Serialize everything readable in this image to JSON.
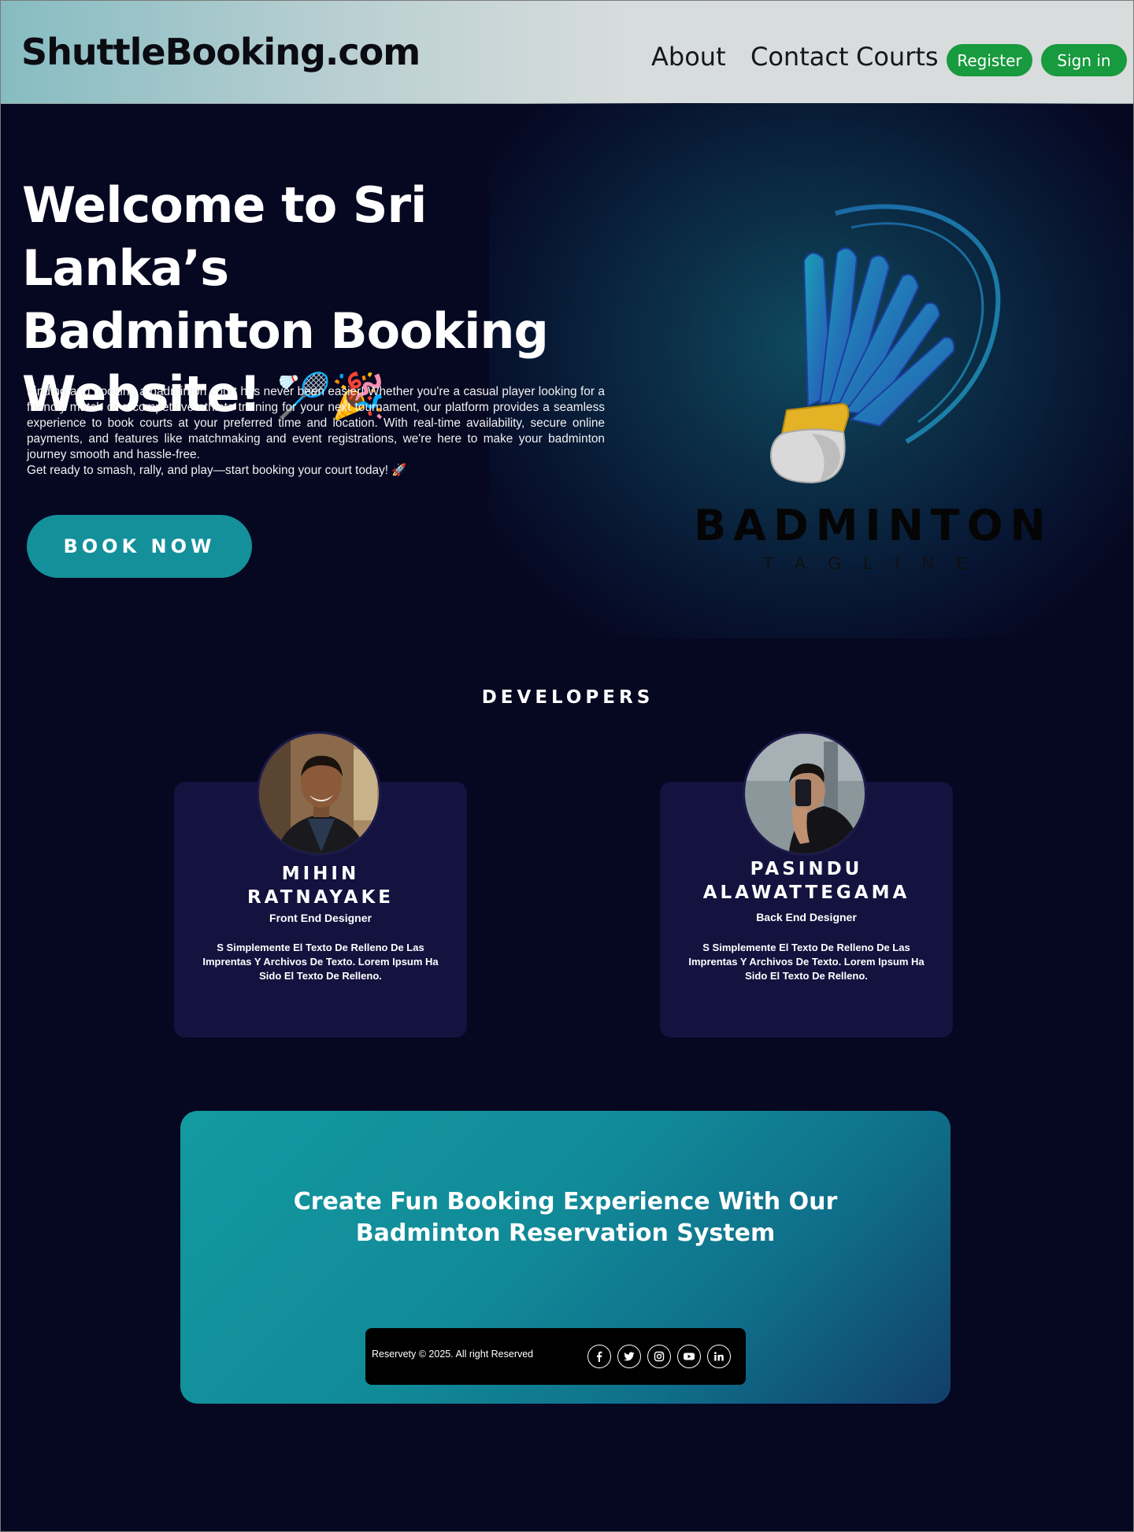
{
  "header": {
    "brand": "ShuttleBooking.com",
    "nav": {
      "about": "About",
      "contact": "Contact",
      "courts": "Courts"
    },
    "register_label": "Register",
    "signin_label": "Sign in"
  },
  "hero": {
    "title_line1": "Welcome to Sri Lanka’s",
    "title_line2": "Badminton Booking",
    "title_line3": "Website!",
    "title_emoji": "🏸🎉",
    "paragraph": "Finding and booking a badminton court has never been easier! Whether you're a casual player looking for a friendly match or a competitive athlete training for your next tournament, our platform provides a seamless experience to book courts at your preferred time and location. With real-time availability, secure online payments, and features like matchmaking and event registrations, we're here to make your badminton journey smooth and hassle-free.",
    "paragraph2": "Get ready to smash, rally, and play—start booking your court today! 🚀",
    "book_button": "BOOK NOW",
    "logo_word": "BADMINTON",
    "logo_tagline": "TAGLINE"
  },
  "developers": {
    "heading": "DEVELOPERS",
    "cards": [
      {
        "name_line1": "MIHIN",
        "name_line2": "RATNAYAKE",
        "role": "Front End Designer",
        "description": "S Simplemente El Texto De Relleno De Las Imprentas Y Archivos De Texto. Lorem Ipsum Ha Sido El Texto De Relleno."
      },
      {
        "name_line1": "PASINDU",
        "name_line2": "ALAWATTEGAMA",
        "role": "Back End Designer",
        "description": "S Simplemente El Texto De Relleno De Las Imprentas Y Archivos De Texto. Lorem Ipsum Ha Sido El Texto De Relleno."
      }
    ]
  },
  "cta": {
    "title_line1": "Create Fun Booking Experience With Our",
    "title_line2": "Badminton Reservation System"
  },
  "footer": {
    "copyright": "Reservety © 2025. All right Reserved",
    "social_icons": [
      "facebook-icon",
      "twitter-icon",
      "instagram-icon",
      "youtube-icon",
      "linkedin-icon"
    ]
  },
  "colors": {
    "background": "#060720",
    "accent_teal": "#14909b",
    "button_green": "#189a3e",
    "card_bg": "#14123e"
  }
}
